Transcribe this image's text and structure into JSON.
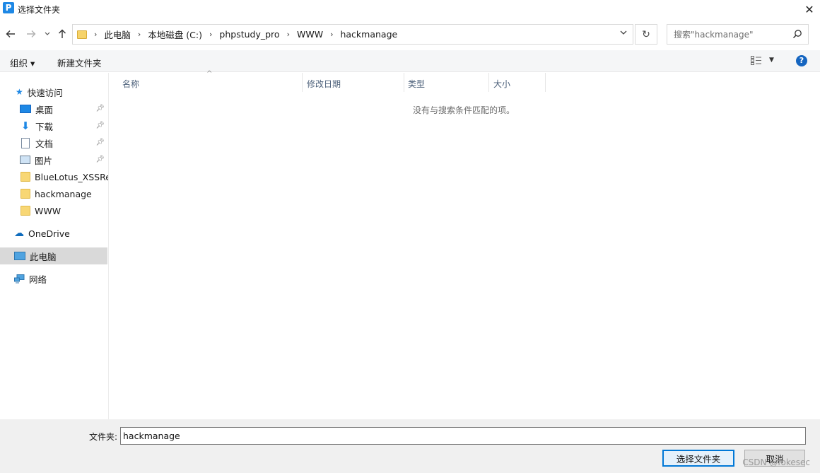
{
  "window": {
    "title": "选择文件夹",
    "app_icon_letter": "P",
    "close_glyph": "✕"
  },
  "address": {
    "crumbs": [
      "此电脑",
      "本地磁盘 (C:)",
      "phpstudy_pro",
      "WWW",
      "hackmanage"
    ],
    "search_placeholder": "搜索\"hackmanage\""
  },
  "toolbar": {
    "organize_label": "组织 ▾",
    "new_folder_label": "新建文件夹",
    "help_label": "?"
  },
  "sidebar": {
    "quick_access": "快速访问",
    "items": [
      {
        "label": "桌面",
        "icon": "desktop-icon",
        "pinned": true
      },
      {
        "label": "下载",
        "icon": "download-icon",
        "pinned": true
      },
      {
        "label": "文档",
        "icon": "document-icon",
        "pinned": true
      },
      {
        "label": "图片",
        "icon": "picture-icon",
        "pinned": true
      },
      {
        "label": "BlueLotus_XSSRec",
        "icon": "folder-icon",
        "pinned": false
      },
      {
        "label": "hackmanage",
        "icon": "folder-icon",
        "pinned": false
      },
      {
        "label": "WWW",
        "icon": "folder-icon",
        "pinned": false
      }
    ],
    "onedrive": "OneDrive",
    "this_pc": "此电脑",
    "network": "网络",
    "selected": "此电脑"
  },
  "list": {
    "columns": [
      "名称",
      "修改日期",
      "类型",
      "大小"
    ],
    "empty_message": "没有与搜索条件匹配的项。"
  },
  "footer": {
    "folder_label": "文件夹:",
    "folder_value": "hackmanage",
    "select_button": "选择文件夹",
    "cancel_button": "取消",
    "watermark": "CSDN @fokesec"
  },
  "colors": {
    "accent": "#0078d7",
    "help": "#1565c0",
    "folder": "#f8d775",
    "selected_bg": "#d9d9d9"
  }
}
